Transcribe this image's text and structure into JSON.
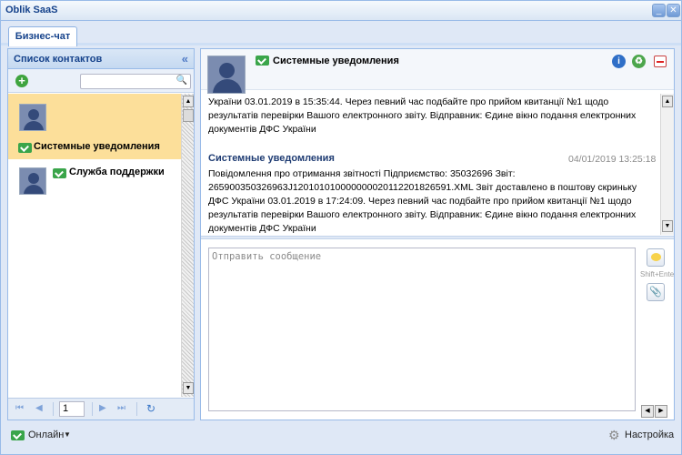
{
  "window": {
    "title": "Oblik SaaS"
  },
  "tabs": [
    {
      "label": "Бизнес-чат"
    }
  ],
  "contacts_panel": {
    "title": "Список контактов",
    "search_placeholder": "",
    "contacts": [
      {
        "name": "Системные уведомления",
        "selected": true
      },
      {
        "name": "Служба поддержки",
        "selected": false
      }
    ],
    "pager": {
      "page": "1"
    }
  },
  "conversation": {
    "title": "Системные уведомления",
    "messages": [
      {
        "sender": "",
        "time": "",
        "text": "України 03.01.2019 в 15:35:44. Через певний час подбайте про прийом квитанції №1 щодо результатів перевірки Вашого електронного звіту. Відправник: Єдине вікно подання електронних документів ДФС України"
      },
      {
        "sender": "Системные уведомления",
        "time": "04/01/2019 13:25:18",
        "text": "Повідомлення про отримання звітності Підприємство: 35032696 Звіт: 265900350326963J120101010000000020112201826591.XML Звіт доставлено в поштову скриньку ДФС України 03.01.2019 в 17:24:09. Через певний час подбайте про прийом квитанції №1 щодо результатів перевірки Вашого електронного звіту. Відправник: Єдине вікно подання електронних документів ДФС України"
      }
    ],
    "compose_placeholder": "Отправить сообщение",
    "send_hotkey": "Shift+Enter"
  },
  "footer": {
    "status_label": "Онлайн",
    "settings_label": "Настройка"
  }
}
